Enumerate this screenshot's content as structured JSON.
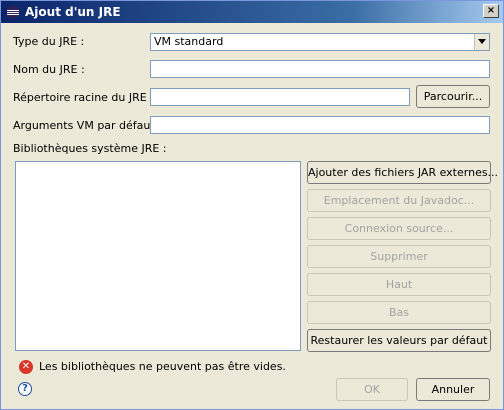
{
  "window": {
    "title": "Ajout d'un JRE",
    "close_label": "×"
  },
  "form": {
    "jre_type": {
      "label": "Type du JRE :",
      "value": "VM standard"
    },
    "jre_name": {
      "label": "Nom du JRE :",
      "value": ""
    },
    "jre_home": {
      "label": "Répertoire racine du JRE :",
      "value": "",
      "browse_label": "Parcourir..."
    },
    "vm_args": {
      "label": "Arguments VM par défaut :",
      "value": ""
    },
    "libraries": {
      "label": "Bibliothèques système JRE :"
    }
  },
  "library_buttons": {
    "add_external_jars": "Ajouter des fichiers JAR externes...",
    "javadoc_location": "Emplacement du Javadoc...",
    "source_attachment": "Connexion source...",
    "remove": "Supprimer",
    "up": "Haut",
    "down": "Bas",
    "restore_defaults": "Restaurer les valeurs par défaut"
  },
  "status": {
    "message": "Les bibliothèques ne peuvent pas être vides."
  },
  "footer": {
    "ok_label": "OK",
    "cancel_label": "Annuler"
  },
  "colors": {
    "title_start": "#0a246a",
    "title_end": "#a6caf0",
    "error": "#d9362c",
    "field_border": "#7f9db9"
  }
}
